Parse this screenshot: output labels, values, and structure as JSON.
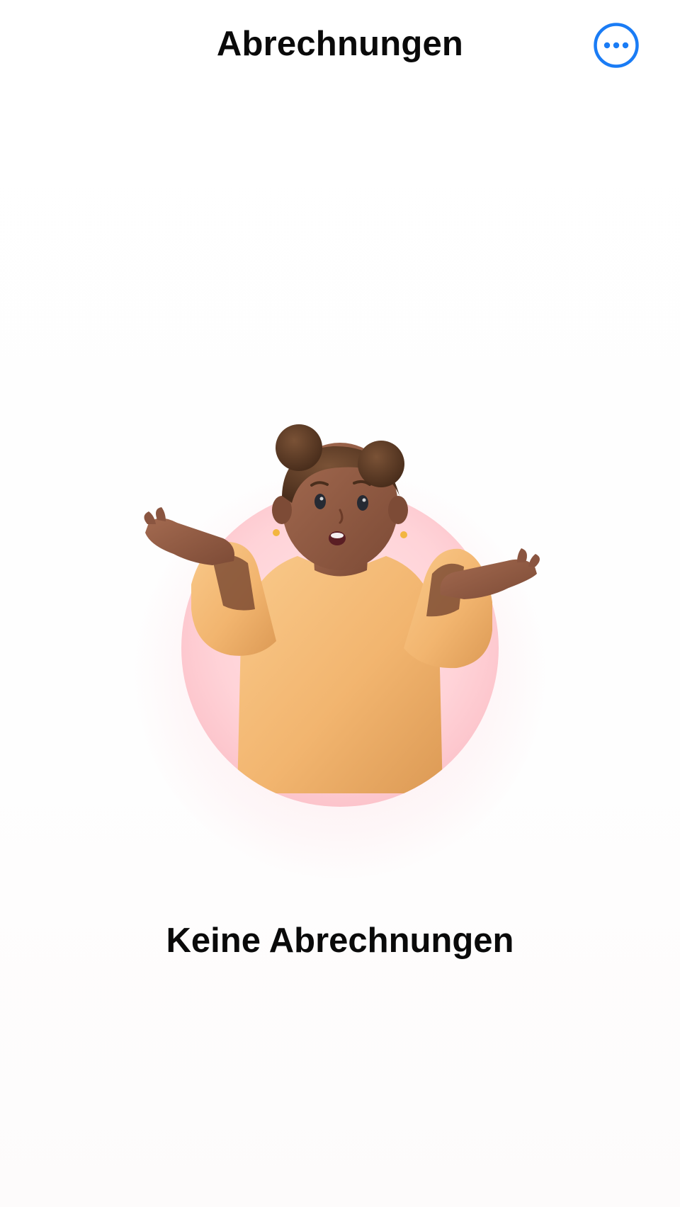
{
  "header": {
    "title": "Abrechnungen",
    "more_icon": "ellipsis-circle-icon",
    "accent_color": "#1a7cf5"
  },
  "empty_state": {
    "illustration": "shrugging-person-illustration",
    "title": "Keine Abrechnungen"
  }
}
